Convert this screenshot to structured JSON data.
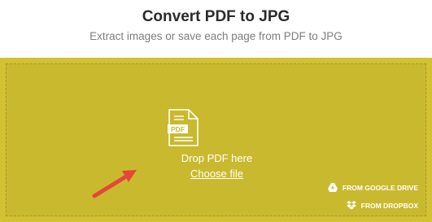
{
  "header": {
    "title": "Convert PDF to JPG",
    "subtitle": "Extract images or save each page from PDF to JPG"
  },
  "dropzone": {
    "file_icon_label": "PDF",
    "drop_text": "Drop PDF here",
    "choose_file_label": "Choose file",
    "google_drive_label": "FROM GOOGLE DRIVE",
    "dropbox_label": "FROM DROPBOX"
  },
  "icons": {
    "file": "pdf-file-icon",
    "google_drive": "google-drive-icon",
    "dropbox": "dropbox-icon",
    "annotation": "red-arrow-icon"
  },
  "colors": {
    "dropzone_bg": "#d2c133",
    "text_light": "#ffffff",
    "title": "#2b2b2b",
    "subtitle": "#7d7d7d",
    "arrow": "#e6463a"
  }
}
